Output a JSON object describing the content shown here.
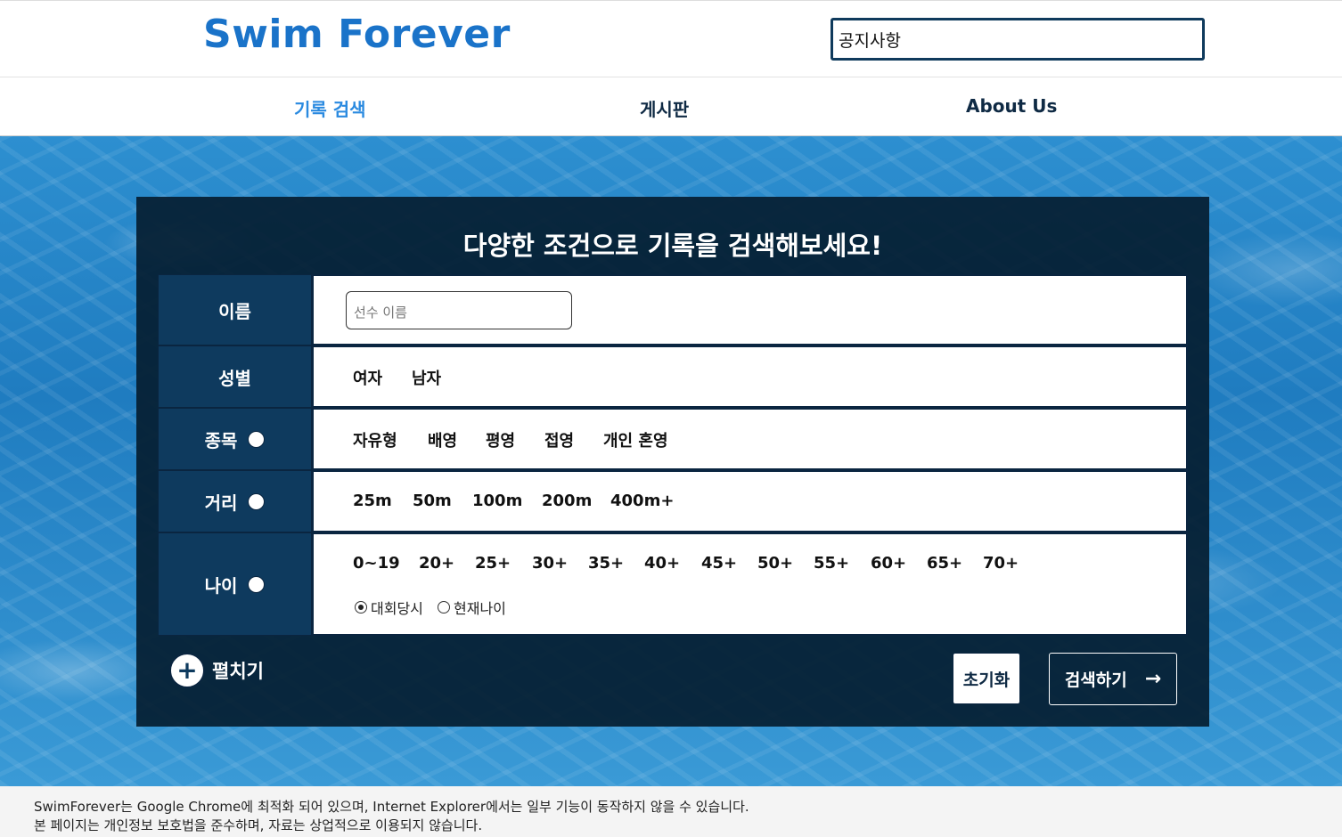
{
  "header": {
    "logo": "Swim Forever",
    "notice": "공지사항"
  },
  "nav": {
    "items": [
      {
        "label": "기록 검색",
        "active": true
      },
      {
        "label": "게시판",
        "active": false
      },
      {
        "label": "About Us",
        "active": false
      }
    ]
  },
  "panel": {
    "title": "다양한 조건으로 기록을 검색해보세요!",
    "rows": {
      "name": {
        "label": "이름",
        "placeholder": "선수 이름"
      },
      "gender": {
        "label": "성별",
        "options": [
          "여자",
          "남자"
        ]
      },
      "event": {
        "label": "종목",
        "options": [
          "자유형",
          "배영",
          "평영",
          "접영",
          "개인 혼영"
        ]
      },
      "distance": {
        "label": "거리",
        "options": [
          "25m",
          "50m",
          "100m",
          "200m",
          "400m+"
        ]
      },
      "age": {
        "label": "나이",
        "options": [
          "0~19",
          "20+",
          "25+",
          "30+",
          "35+",
          "40+",
          "45+",
          "50+",
          "55+",
          "60+",
          "65+",
          "70+"
        ],
        "mode_options": [
          {
            "label": "대회당시",
            "selected": true
          },
          {
            "label": "현재나이",
            "selected": false
          }
        ]
      }
    },
    "expand_label": "펼치기",
    "reset_label": "초기화",
    "search_label": "검색하기",
    "search_arrow": "→"
  },
  "footer": {
    "line1": "SwimForever는 Google Chrome에 최적화 되어 있으며, Internet Explorer에서는 일부 기능이 동작하지 않을 수 있습니다.",
    "line2": "본 페이지는 개인정보 보호법을 준수하며, 자료는 상업적으로 이용되지 않습니다."
  },
  "colors": {
    "brand": "#1a73c9",
    "nav_active": "#2a8ae0",
    "label_bg": "#0e3a5e",
    "panel_bg": "#051e32"
  }
}
